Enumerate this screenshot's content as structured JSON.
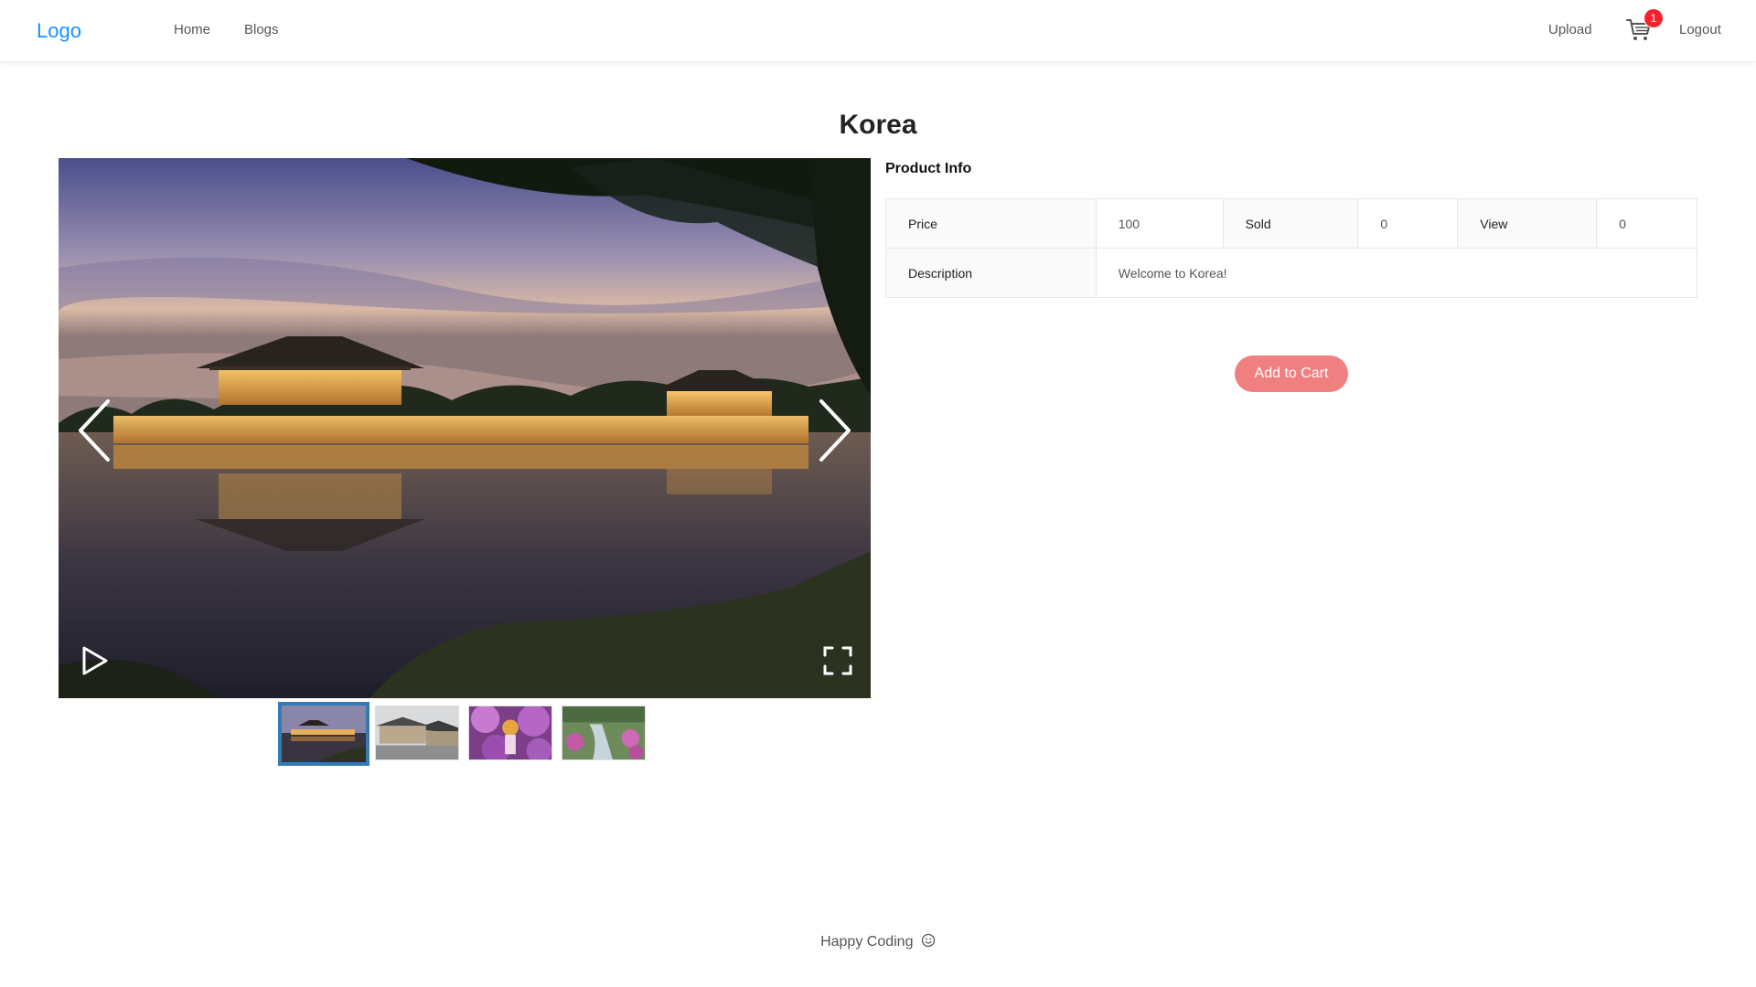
{
  "nav": {
    "logo": "Logo",
    "home": "Home",
    "blogs": "Blogs",
    "upload": "Upload",
    "cart_count": "1",
    "logout": "Logout",
    "cart_icon": "shopping-cart-icon",
    "badge_color": "#f5222d"
  },
  "product": {
    "title": "Korea",
    "info_heading": "Product Info",
    "price_label": "Price",
    "price_value": "100",
    "sold_label": "Sold",
    "sold_value": "0",
    "view_label": "View",
    "view_value": "0",
    "description_label": "Description",
    "description_value": "Welcome to Korea!",
    "add_to_cart": "Add to Cart",
    "button_color": "#f08080"
  },
  "gallery": {
    "prev_icon": "chevron-left-icon",
    "next_icon": "chevron-right-icon",
    "play_icon": "play-icon",
    "fullscreen_icon": "fullscreen-icon",
    "thumbnails": [
      "thumb-palace-night",
      "thumb-hanok-village",
      "thumb-cherry-blossom",
      "thumb-garden-stream"
    ],
    "active_thumbnail": 1
  },
  "footer": {
    "text": "Happy Coding",
    "icon": "smile-icon"
  }
}
